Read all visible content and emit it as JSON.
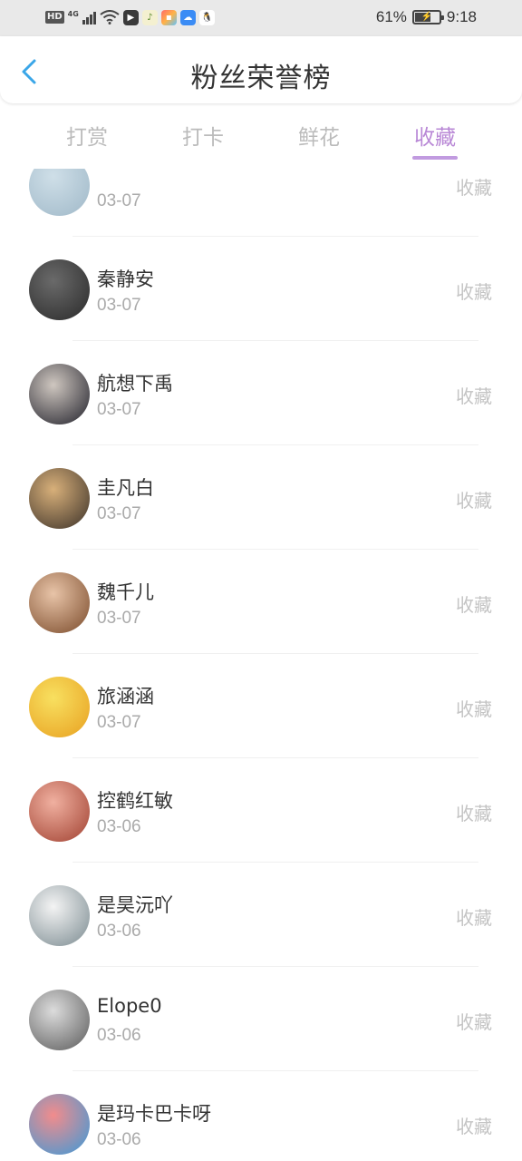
{
  "status_bar": {
    "hd": "HD",
    "network": "4G",
    "battery_percent": "61%",
    "battery_level": 0.61,
    "time": "9:18",
    "apps": [
      "bilibili-icon",
      "qq-music-icon",
      "app-store-icon",
      "cloud-icon",
      "qq-icon"
    ]
  },
  "header": {
    "back_icon": "back-arrow-icon",
    "title": "粉丝荣誉榜"
  },
  "tabs": [
    {
      "label": "打赏",
      "active": false
    },
    {
      "label": "打卡",
      "active": false
    },
    {
      "label": "鲜花",
      "active": false
    },
    {
      "label": "收藏",
      "active": true
    }
  ],
  "colors": {
    "accent": "#b988d6",
    "inactive_tab": "#bbbbbb",
    "back_arrow": "#3aa6e8"
  },
  "fans": [
    {
      "name": "",
      "date": "03-07",
      "action": "收藏",
      "avatar": [
        "#cfdfe8",
        "#9fb8c8"
      ]
    },
    {
      "name": "秦静安",
      "date": "03-07",
      "action": "收藏",
      "avatar": [
        "#6a6a6a",
        "#2a2a2a"
      ]
    },
    {
      "name": "航想下禹",
      "date": "03-07",
      "action": "收藏",
      "avatar": [
        "#cfc7c0",
        "#20202a"
      ]
    },
    {
      "name": "圭凡白",
      "date": "03-07",
      "action": "收藏",
      "avatar": [
        "#d8b07a",
        "#3a3028"
      ]
    },
    {
      "name": "魏千儿",
      "date": "03-07",
      "action": "收藏",
      "avatar": [
        "#e8c4a8",
        "#7a4a2a"
      ]
    },
    {
      "name": "旅涵涵",
      "date": "03-07",
      "action": "收藏",
      "avatar": [
        "#f8e060",
        "#e8a020"
      ]
    },
    {
      "name": "控鹤红敏",
      "date": "03-06",
      "action": "收藏",
      "avatar": [
        "#f0b0a0",
        "#a04030"
      ]
    },
    {
      "name": "是昊沅吖",
      "date": "03-06",
      "action": "收藏",
      "avatar": [
        "#f4f4f4",
        "#7a8a90"
      ]
    },
    {
      "name": "Elope0",
      "date": "03-06",
      "action": "收藏",
      "avatar": [
        "#dcdcdc",
        "#5a5a5a"
      ]
    },
    {
      "name": "是玛卡巴卡呀",
      "date": "03-06",
      "action": "收藏",
      "avatar": [
        "#f28c8c",
        "#3a9ad9"
      ]
    }
  ]
}
